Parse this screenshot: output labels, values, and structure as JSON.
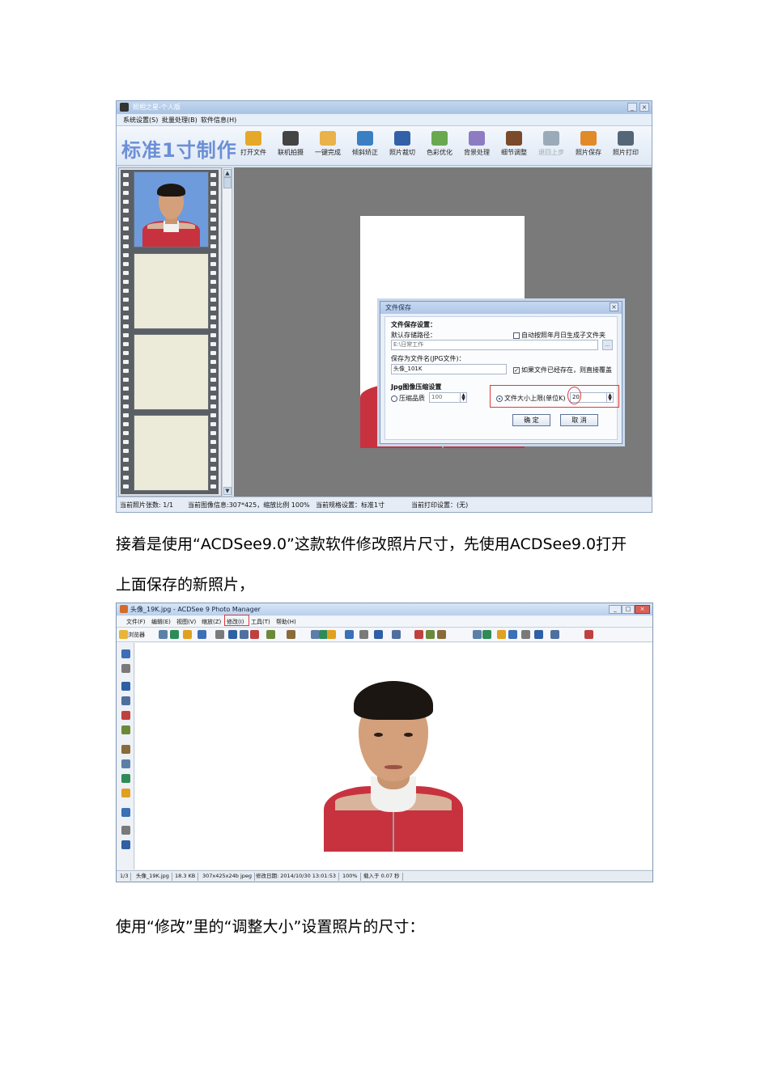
{
  "paragraphs": {
    "p1_line1": "接着是使用“ACDSee9.0”这款软件修改照片尺寸，先使用ACDSee9.0打开",
    "p1_line2": "上面保存的新照片，",
    "p2": "使用“修改”里的“调整大小”设置照片的尺寸："
  },
  "shot1": {
    "title": "照相之星-个人版",
    "menu": [
      "系统设置(S)",
      "批量处理(B)",
      "软件信息(H)"
    ],
    "brand": "标准1寸制作",
    "toolbar": [
      {
        "label": "打开文件",
        "icon": "folder-icon",
        "color": "#e5a82a",
        "enabled": true
      },
      {
        "label": "联机拍摄",
        "icon": "camera-icon",
        "color": "#444444",
        "enabled": true
      },
      {
        "label": "一键完成",
        "icon": "hand-icon",
        "color": "#e9b24a",
        "enabled": true
      },
      {
        "label": "倾斜矫正",
        "icon": "rotate-icon",
        "color": "#3a7fc4",
        "enabled": true
      },
      {
        "label": "照片裁切",
        "icon": "crop-icon",
        "color": "#3261a8",
        "enabled": true
      },
      {
        "label": "色彩优化",
        "icon": "color-icon",
        "color": "#6aa84f",
        "enabled": true
      },
      {
        "label": "背景处理",
        "icon": "brush-icon",
        "color": "#8e7cc3",
        "enabled": true
      },
      {
        "label": "细节调整",
        "icon": "levels-icon",
        "color": "#7a4a2a",
        "enabled": true
      },
      {
        "label": "退回上步",
        "icon": "undo-icon",
        "color": "#9aaab8",
        "enabled": false
      },
      {
        "label": "照片保存",
        "icon": "save-icon",
        "color": "#e08a2a",
        "enabled": true
      },
      {
        "label": "照片打印",
        "icon": "printer-icon",
        "color": "#556677",
        "enabled": true
      }
    ],
    "dialog": {
      "title": "文件保存",
      "section_save": "文件保存设置：",
      "default_path_label": "默认存储路径：",
      "auto_subfolder_label": "自动按照年月日生成子文件夹",
      "path_value": "E:\\日常工作",
      "browse_label": "...",
      "filename_label": "保存为文件名(JPG文件)：",
      "filename_value": "头像_101K",
      "overwrite_label": "如果文件已经存在，则直接覆盖",
      "section_jpg": "Jpg图像压缩设置",
      "quality_label": "压缩品质",
      "quality_value": "100",
      "size_limit_label": "文件大小上限(单位K)",
      "size_limit_value": "20",
      "ok_label": "确 定",
      "cancel_label": "取 消"
    },
    "status": [
      "当前照片张数: 1/1",
      "当前图像信息:307*425，缩放比例 100%",
      "当前规格设置：标准1寸",
      "当前打印设置：(无)"
    ]
  },
  "shot2": {
    "title": "头像_19K.jpg - ACDSee 9 Photo Manager",
    "window_buttons": [
      "_",
      "□",
      "×"
    ],
    "menu": [
      "文件(F)",
      "编辑(E)",
      "视图(V)",
      "缩放(Z)",
      "修改(I)",
      "工具(T)",
      "帮助(H)"
    ],
    "highlighted_menu": "修改(I)",
    "browse_label": "浏览器",
    "status": [
      "1/3",
      "头像_19K.jpg",
      "18.3 KB",
      "307x425x24b jpeg",
      "修改日期: 2014/10/30 13:01:53",
      "100%",
      "载入于 0.07 秒"
    ]
  }
}
